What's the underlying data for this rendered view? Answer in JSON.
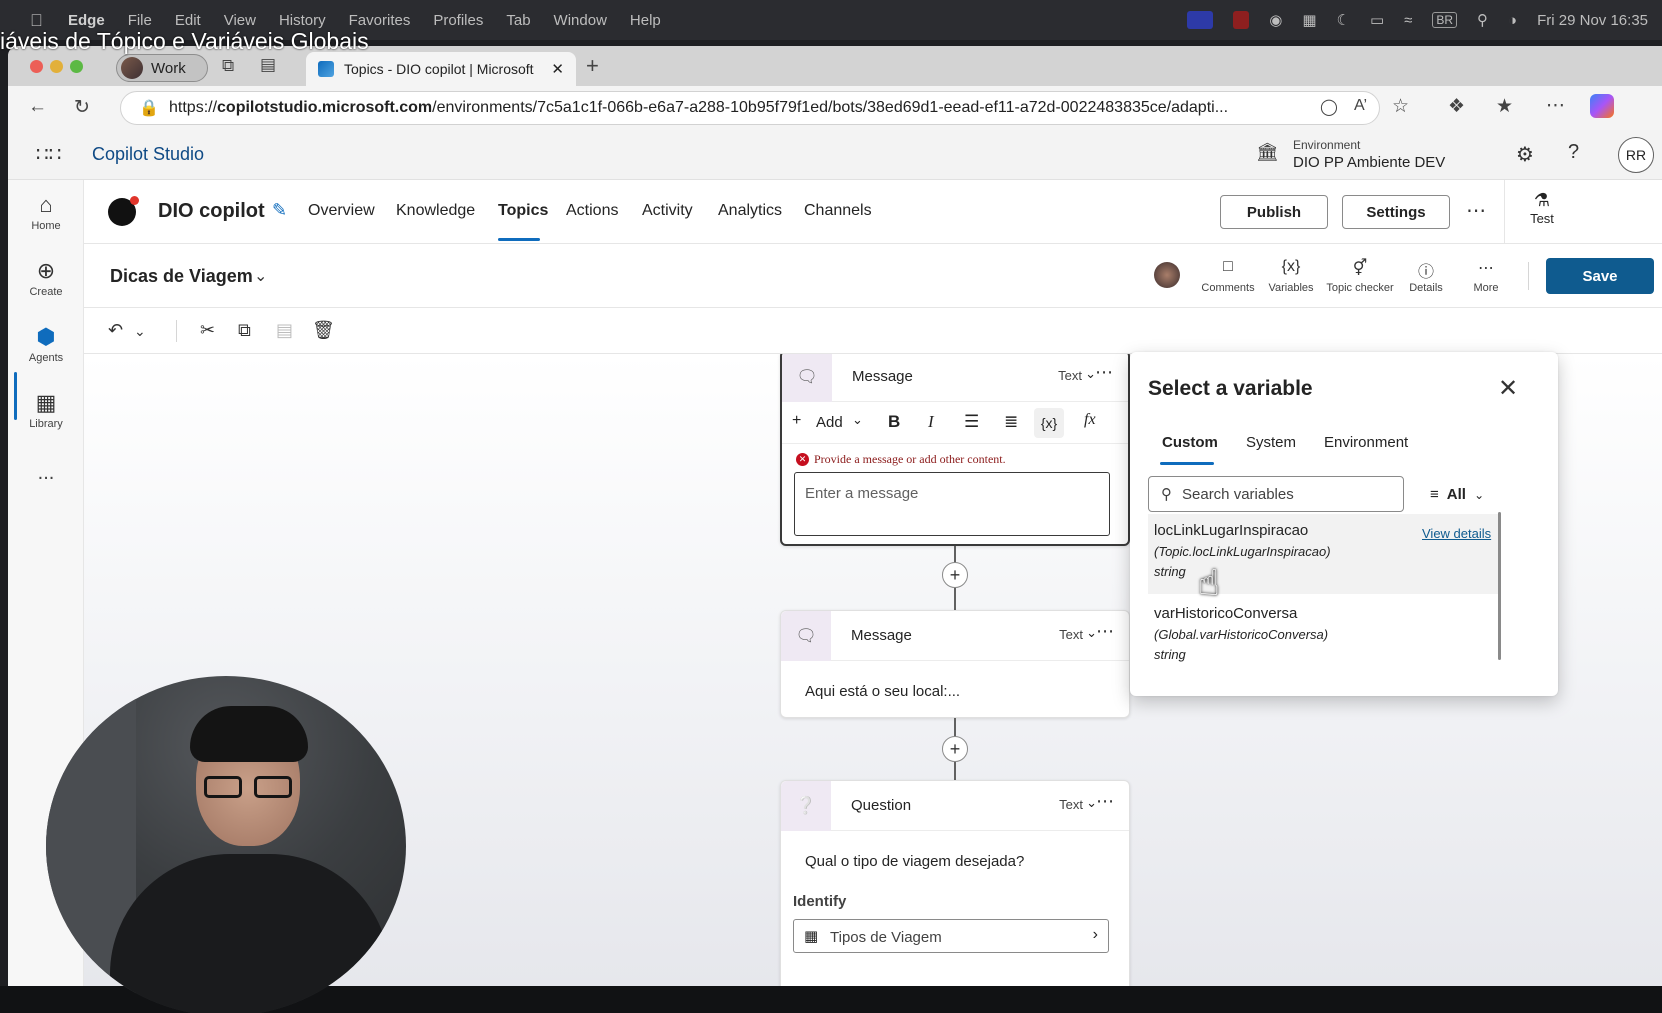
{
  "caption": "iáveis de Tópico e Variáveis Globais",
  "menubar": {
    "app": "Edge",
    "items": [
      "File",
      "Edit",
      "View",
      "History",
      "Favorites",
      "Profiles",
      "Tab",
      "Window",
      "Help"
    ],
    "keyboard": "BR",
    "clock": "Fri 29 Nov  16:35"
  },
  "browser": {
    "profile": "Work",
    "active_tab": "Topics - DIO copilot | Microsoft",
    "url_prefix": "https://",
    "url_host": "copilotstudio.microsoft.com",
    "url_path": "/environments/7c5a1c1f-066b-e6a7-a288-10b95f79f1ed/bots/38ed69d1-eead-ef11-a72d-0022483835ce/adapti..."
  },
  "app": {
    "title": "Copilot Studio",
    "environment_label": "Environment",
    "environment_name": "DIO PP Ambiente DEV",
    "user_initials": "RR"
  },
  "rail": {
    "home": "Home",
    "create": "Create",
    "agents": "Agents",
    "library": "Library",
    "more": "..."
  },
  "agent": {
    "name": "DIO copilot",
    "tabs": [
      "Overview",
      "Knowledge",
      "Topics",
      "Actions",
      "Activity",
      "Analytics",
      "Channels"
    ],
    "active_tab": "Topics",
    "publish": "Publish",
    "settings": "Settings",
    "test": "Test"
  },
  "topic": {
    "title": "Dicas de Viagem",
    "tools": {
      "comments": "Comments",
      "variables": "Variables",
      "topic_checker": "Topic checker",
      "details": "Details",
      "more": "More"
    },
    "save": "Save"
  },
  "nodes": {
    "message1": {
      "title": "Message",
      "type": "Text",
      "add_label": "Add",
      "error": "Provide a message or add other content.",
      "placeholder": "Enter a message"
    },
    "message2": {
      "title": "Message",
      "type": "Text",
      "content": "Aqui está o seu local:..."
    },
    "question": {
      "title": "Question",
      "type": "Text",
      "content": "Qual o tipo de viagem desejada?",
      "identify_label": "Identify",
      "identify_value": "Tipos de Viagem"
    }
  },
  "variable_picker": {
    "title": "Select a variable",
    "tabs": [
      "Custom",
      "System",
      "Environment"
    ],
    "active_tab": "Custom",
    "search_placeholder": "Search variables",
    "filter": "All",
    "view_details": "View details",
    "items": [
      {
        "name": "locLinkLugarInspiracao",
        "path": "(Topic.locLinkLugarInspiracao)",
        "kind": "string"
      },
      {
        "name": "varHistoricoConversa",
        "path": "(Global.varHistoricoConversa)",
        "kind": "string"
      }
    ]
  },
  "colors": {
    "accent": "#0f6cbd",
    "save_button": "#0f5b8f",
    "error": "#c50f1f"
  }
}
